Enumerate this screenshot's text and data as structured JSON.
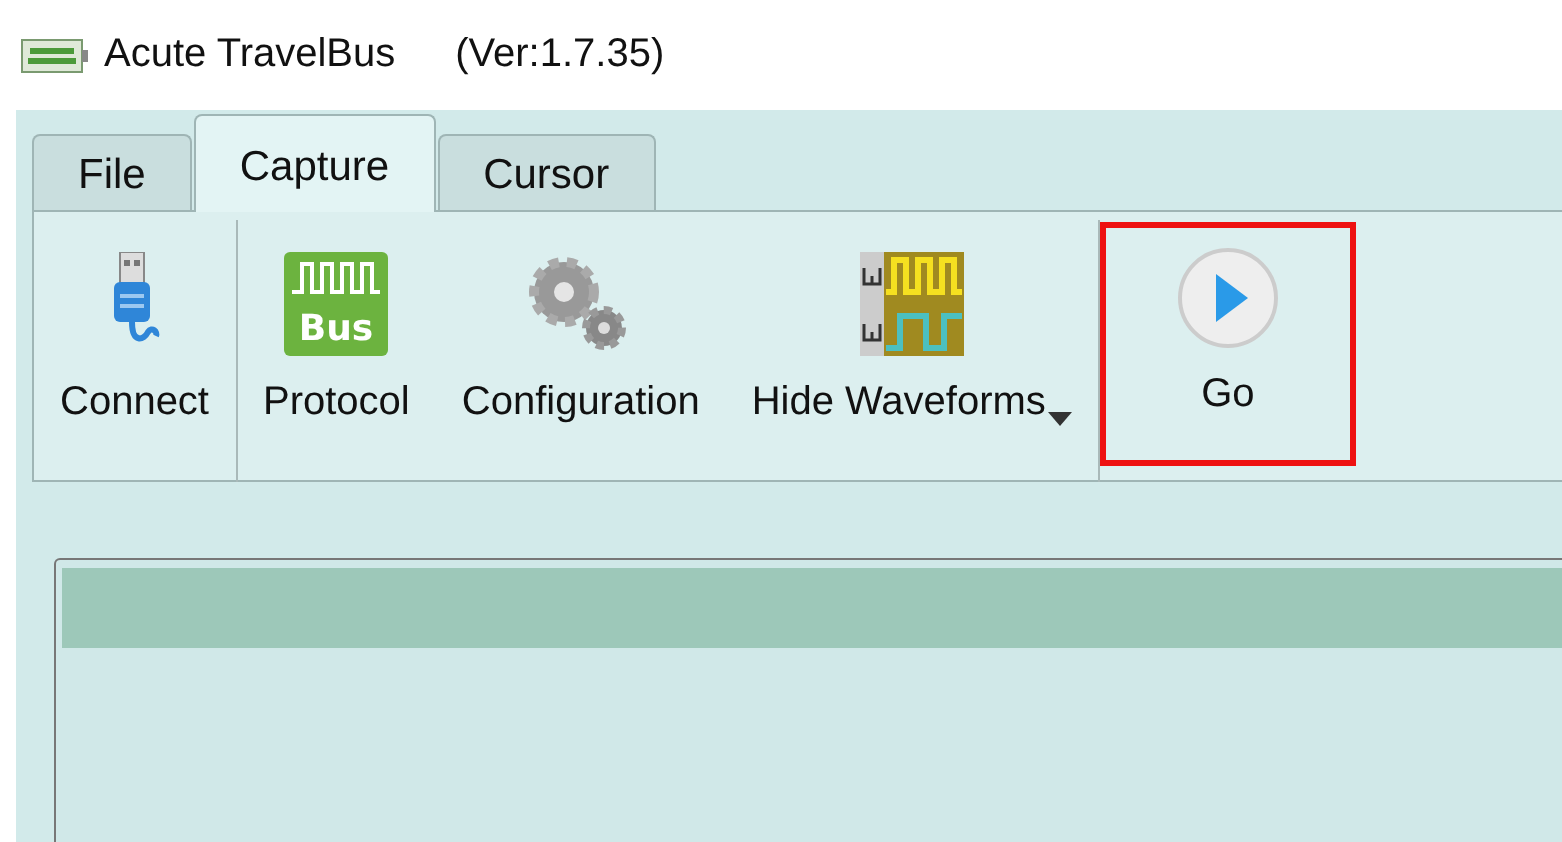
{
  "window": {
    "title": "Acute TravelBus",
    "version": "(Ver:1.7.35)"
  },
  "tabs": [
    {
      "label": "File",
      "selected": false
    },
    {
      "label": "Capture",
      "selected": true
    },
    {
      "label": "Cursor",
      "selected": false
    }
  ],
  "toolbar": {
    "groups": [
      [
        {
          "kind": "usb",
          "label": "Connect",
          "dropdown": false,
          "highlighted": false
        }
      ],
      [
        {
          "kind": "bus",
          "icon_text": "Bus",
          "label": "Protocol",
          "dropdown": false,
          "highlighted": false
        },
        {
          "kind": "gears",
          "label": "Configuration",
          "dropdown": false,
          "highlighted": false
        },
        {
          "kind": "waves",
          "label": "Hide Waveforms",
          "dropdown": true,
          "highlighted": false
        }
      ],
      [
        {
          "kind": "play",
          "label": "Go",
          "dropdown": false,
          "highlighted": true
        }
      ]
    ]
  }
}
